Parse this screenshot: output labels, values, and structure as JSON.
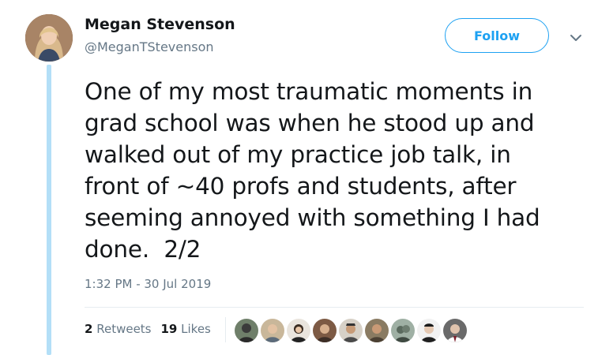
{
  "tweet": {
    "author_name": "Megan Stevenson",
    "author_handle": "@MeganTStevenson",
    "follow_label": "Follow",
    "text": "One of my most traumatic moments in\ngrad school was when he stood up and\nwalked out of my practice job talk, in\nfront of ~40 profs and students, after\nseeming annoyed with something I had\ndone.  2/2",
    "timestamp": "1:32 PM - 30 Jul 2019",
    "retweets_count": "2",
    "retweets_label": "Retweets",
    "likes_count": "19",
    "likes_label": "Likes"
  },
  "colors": {
    "accent": "#1da1f2",
    "thread_line": "#b3dff7",
    "secondary_text": "#657786"
  },
  "icons": {
    "caret": "chevron-down-icon"
  }
}
